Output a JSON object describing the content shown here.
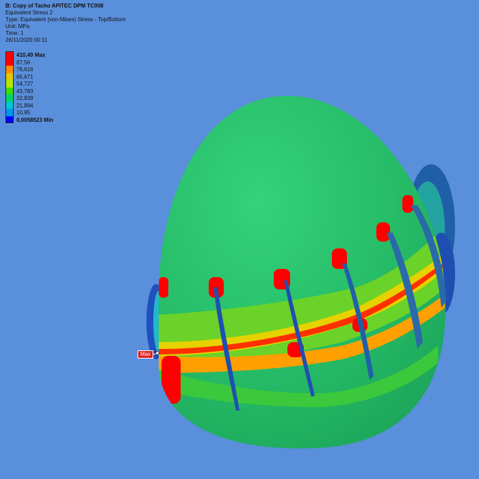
{
  "info": {
    "title": "B: Copy of Tacho APITEC DPM TC008",
    "result": "Equivalent Stress 2",
    "type": "Type: Equivalent (von-Mises) Stress - Top/Bottom",
    "unit": "Unit: MPa",
    "time": "Time: 1",
    "date": "26/11/2020 00:11"
  },
  "legend": {
    "max_label": "410,49 Max",
    "min_label": "0,0058523 Min",
    "levels": [
      "87,56",
      "76,616",
      "65,671",
      "54,727",
      "43,783",
      "32,839",
      "21,894",
      "10,95"
    ],
    "colors": [
      "#ff0000",
      "#ff8c00",
      "#e0c800",
      "#b4e600",
      "#3cdc00",
      "#00d26e",
      "#00c8d2",
      "#0096f0",
      "#0000ff"
    ]
  },
  "probe": {
    "label": "Max"
  },
  "colors": {
    "background": "#5a8fdc",
    "shell": "#28bf6a",
    "high": "#ff0000",
    "mid": "#ffa000",
    "low": "#1e5cc8"
  }
}
